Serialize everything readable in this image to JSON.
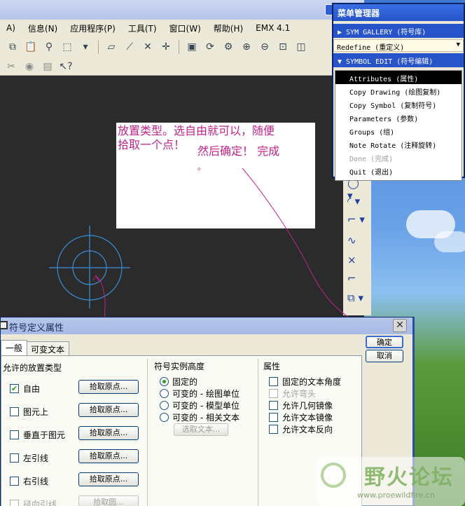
{
  "app": {
    "menu": [
      "A)",
      "信息(N)",
      "应用程序(P)",
      "工具(T)",
      "窗口(W)",
      "帮助(H)",
      "EMX 4.1"
    ]
  },
  "annotation": {
    "line1": "放置类型。选自由就可以，随便",
    "line2": "拾取一个点！",
    "line3": "然后确定！ 完成",
    "line4": "。"
  },
  "menu_manager": {
    "title": "菜单管理器",
    "sym_gallery": "▶ SYM GALLERY (符号库)",
    "redefine": "Redefine (重定义)",
    "symbol_edit": "▼ SYMBOL EDIT (符号编辑)",
    "items": [
      {
        "label": "Attributes (属性)",
        "state": "selected"
      },
      {
        "label": "Copy Drawing (绘图复制)",
        "state": "normal"
      },
      {
        "label": "Copy Symbol (复制符号)",
        "state": "normal"
      },
      {
        "label": "Parameters (参数)",
        "state": "normal"
      },
      {
        "label": "Groups (组)",
        "state": "normal"
      },
      {
        "label": "Note Rotate (注释旋转)",
        "state": "normal"
      },
      {
        "label": "Done (完成)",
        "state": "disabled"
      },
      {
        "label": "Quit (退出)",
        "state": "normal"
      }
    ]
  },
  "dialog": {
    "title": "符号定义属性",
    "close": "✕",
    "tabs": [
      "一般",
      "可变文本"
    ],
    "placement": {
      "title": "允许的放置类型",
      "rows": [
        {
          "label": "自由",
          "checked": true,
          "button": "拾取原点..."
        },
        {
          "label": "图元上",
          "checked": false,
          "button": "拾取原点..."
        },
        {
          "label": "垂直于图元",
          "checked": false,
          "button": "拾取原点..."
        },
        {
          "label": "左引线",
          "checked": false,
          "button": "拾取原点..."
        },
        {
          "label": "右引线",
          "checked": false,
          "button": "拾取原点..."
        },
        {
          "label": "径向引线",
          "checked": false,
          "button": "拾取圆..."
        }
      ]
    },
    "height": {
      "title": "符号实例高度",
      "options": [
        "固定的",
        "可变的 - 绘图单位",
        "可变的 - 模型单位",
        "可变的 - 相关文本"
      ],
      "selected": 0,
      "pick_text": "选取文本..."
    },
    "attributes": {
      "title": "属性",
      "items": [
        {
          "label": "固定的文本角度",
          "enabled": true
        },
        {
          "label": "允许弯头",
          "enabled": false
        },
        {
          "label": "允许几何镜像",
          "enabled": true
        },
        {
          "label": "允许文本镜像",
          "enabled": true
        },
        {
          "label": "允许文本反向",
          "enabled": true
        }
      ]
    },
    "ok": "确定",
    "cancel": "取消"
  },
  "watermark": {
    "text": "野火论坛",
    "url": "www.proewildfire.cn"
  },
  "colors": {
    "annotation": "#c0248b",
    "symbol": "#3a8fd8",
    "menu_blue": "#2754c9"
  }
}
